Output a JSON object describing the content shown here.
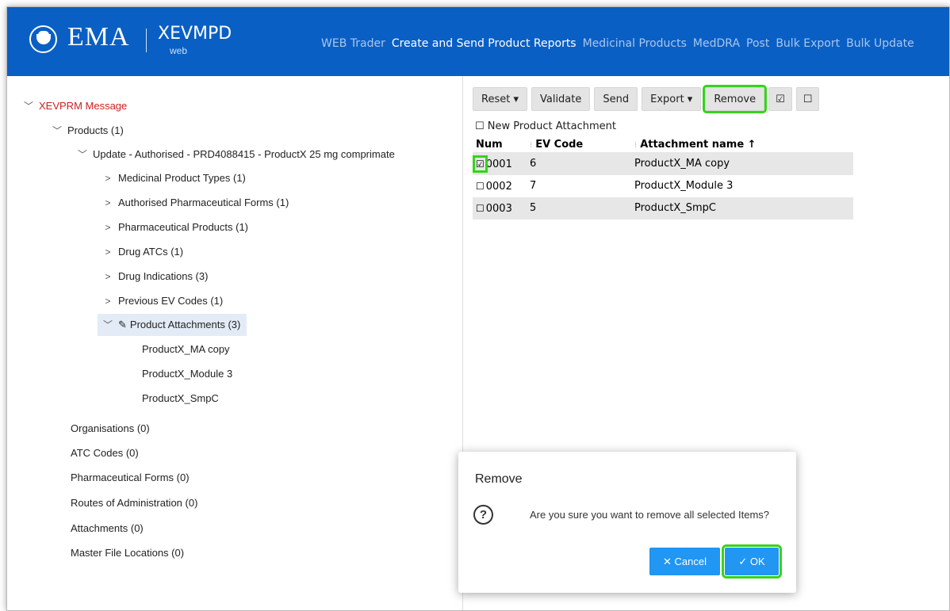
{
  "header": {
    "logo_text": "EMA",
    "product_name": "XEVMPD",
    "product_sub": "web",
    "nav": [
      "WEB Trader",
      "Create and Send Product Reports",
      "Medicinal Products",
      "MedDRA",
      "Post",
      "Bulk Export",
      "Bulk Update"
    ],
    "active_nav": "Create and Send Product Reports"
  },
  "tree": {
    "root": "XEVPRM Message",
    "products": "Products (1)",
    "update": "Update - Authorised - PRD4088415 - ProductX 25 mg comprimate",
    "children": [
      "Medicinal Product Types (1)",
      "Authorised Pharmaceutical Forms (1)",
      "Pharmaceutical Products (1)",
      "Drug ATCs (1)",
      "Drug Indications (3)",
      "Previous EV Codes (1)"
    ],
    "attachments": "Product Attachments (3)",
    "attachment_items": [
      "ProductX_MA copy",
      "ProductX_Module 3",
      "ProductX_SmpC"
    ],
    "other": [
      "Organisations (0)",
      "ATC Codes (0)",
      "Pharmaceutical Forms (0)",
      "Routes of Administration (0)",
      "Attachments (0)",
      "Master File Locations (0)"
    ]
  },
  "toolbar": {
    "reset": "Reset ▾",
    "validate": "Validate",
    "send": "Send",
    "export": "Export ▾",
    "remove": "Remove",
    "select_all": "☑",
    "deselect_all": "☐"
  },
  "new_attachment_label": "New Product Attachment",
  "grid": {
    "headers": [
      "Num",
      "EV Code",
      "Attachment name ↑"
    ],
    "rows": [
      {
        "checked": "☑",
        "num": "0001",
        "ev_code": "6",
        "name": "ProductX_MA copy"
      },
      {
        "checked": "☐",
        "num": "0002",
        "ev_code": "7",
        "name": "ProductX_Module 3"
      },
      {
        "checked": "☐",
        "num": "0003",
        "ev_code": "5",
        "name": "ProductX_SmpC"
      }
    ]
  },
  "modal": {
    "title": "Remove",
    "message": "Are you sure you want to remove all selected Items?",
    "cancel": "✕ Cancel",
    "ok": "✓ OK"
  },
  "colors": {
    "header_bg": "#0a5fc4",
    "highlight": "#35d41c",
    "button_blue": "#2196f3",
    "root_red": "#d02020"
  }
}
